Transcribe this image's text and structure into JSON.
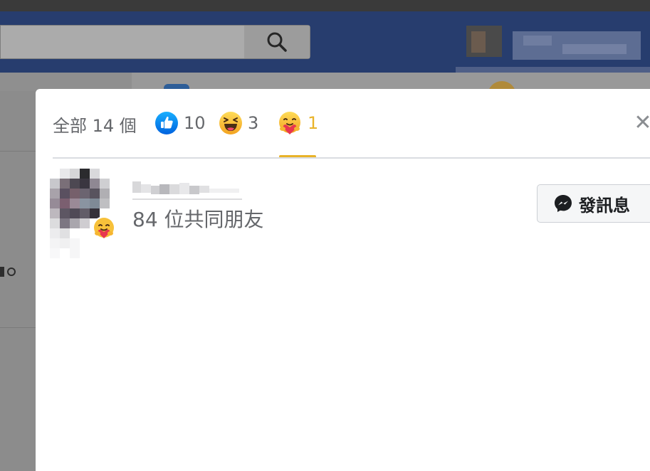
{
  "navbar": {
    "search_icon": "magnifier-icon"
  },
  "dialog": {
    "tabs": {
      "all_label": "全部 14 個",
      "reactions": [
        {
          "id": "like",
          "icon": "like-icon",
          "count": "10",
          "active": false
        },
        {
          "id": "haha",
          "icon": "haha-icon",
          "count": "3",
          "active": false
        },
        {
          "id": "care",
          "icon": "care-icon",
          "count": "1",
          "active": true
        }
      ]
    },
    "close_icon": "close-icon",
    "reactors": [
      {
        "reaction": "care",
        "mutual_friends": "84 位共同朋友",
        "message_button": "發訊息"
      }
    ]
  },
  "colors": {
    "navbar": "#273d6e",
    "active_tab": "#e9b329",
    "like_blue": "#1b74e4",
    "emoji_yellow": "#f7b928"
  }
}
